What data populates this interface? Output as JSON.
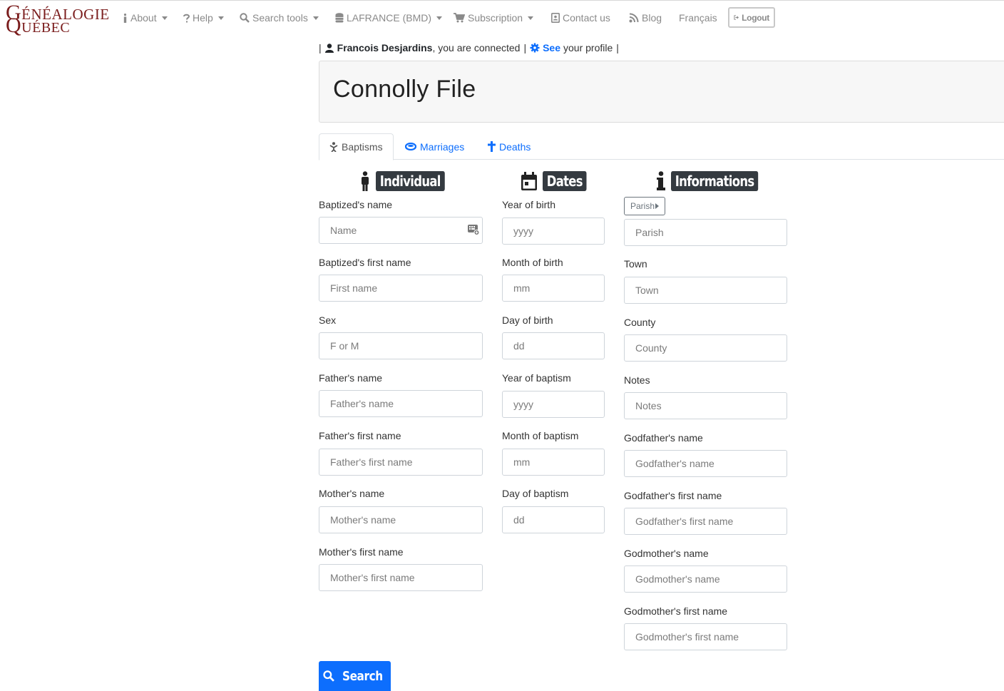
{
  "logo": {
    "top_initial": "G",
    "top_rest": "ÉNÉALOGIE",
    "bottom_initial": "Q",
    "bottom_rest": "UÉBEC"
  },
  "nav": {
    "about": "About",
    "help": "Help",
    "search_tools": "Search tools",
    "lafrance": "LAFRANCE (BMD)",
    "subscription": "Subscription",
    "contact": "Contact us",
    "blog": "Blog",
    "language": "Français",
    "logout": "Logout"
  },
  "user": {
    "pipe": "|",
    "name": "Francois Desjardins",
    "connected": ", you are connected",
    "see": "See",
    "profile": "your profile"
  },
  "page": {
    "title": "Connolly File"
  },
  "tabs": [
    {
      "label": "Baptisms",
      "active": true
    },
    {
      "label": "Marriages",
      "active": false
    },
    {
      "label": "Deaths",
      "active": false
    }
  ],
  "sections": {
    "individual": "Individual",
    "dates": "Dates",
    "informations": "Informations"
  },
  "individual_fields": [
    {
      "label": "Baptized's name",
      "placeholder": "Name"
    },
    {
      "label": "Baptized's first name",
      "placeholder": "First name"
    },
    {
      "label": "Sex",
      "placeholder": "F or M"
    },
    {
      "label": "Father's name",
      "placeholder": "Father's name"
    },
    {
      "label": "Father's first name",
      "placeholder": "Father's first name"
    },
    {
      "label": "Mother's name",
      "placeholder": "Mother's name"
    },
    {
      "label": "Mother's first name",
      "placeholder": "Mother's first name"
    }
  ],
  "date_fields": [
    {
      "label": "Year of birth",
      "placeholder": "yyyy"
    },
    {
      "label": "Month of birth",
      "placeholder": "mm"
    },
    {
      "label": "Day of birth",
      "placeholder": "dd"
    },
    {
      "label": "Year of baptism",
      "placeholder": "yyyy"
    },
    {
      "label": "Month of baptism",
      "placeholder": "mm"
    },
    {
      "label": "Day of baptism",
      "placeholder": "dd"
    }
  ],
  "info_fields": {
    "parish_button": "Parish",
    "parish_placeholder": "Parish",
    "items": [
      {
        "label": "Town",
        "placeholder": "Town"
      },
      {
        "label": "County",
        "placeholder": "County"
      },
      {
        "label": "Notes",
        "placeholder": "Notes"
      },
      {
        "label": "Godfather's name",
        "placeholder": "Godfather's name"
      },
      {
        "label": "Godfather's first name",
        "placeholder": "Godfather's first name"
      },
      {
        "label": "Godmother's name",
        "placeholder": "Godmother's name"
      },
      {
        "label": "Godmother's first name",
        "placeholder": "Godmother's first name"
      }
    ]
  },
  "search_button": "Search",
  "colors": {
    "brand": "#7a1c1c",
    "primary": "#0d6efd",
    "badge": "#343a40",
    "nav_text": "#8a8a8a"
  }
}
